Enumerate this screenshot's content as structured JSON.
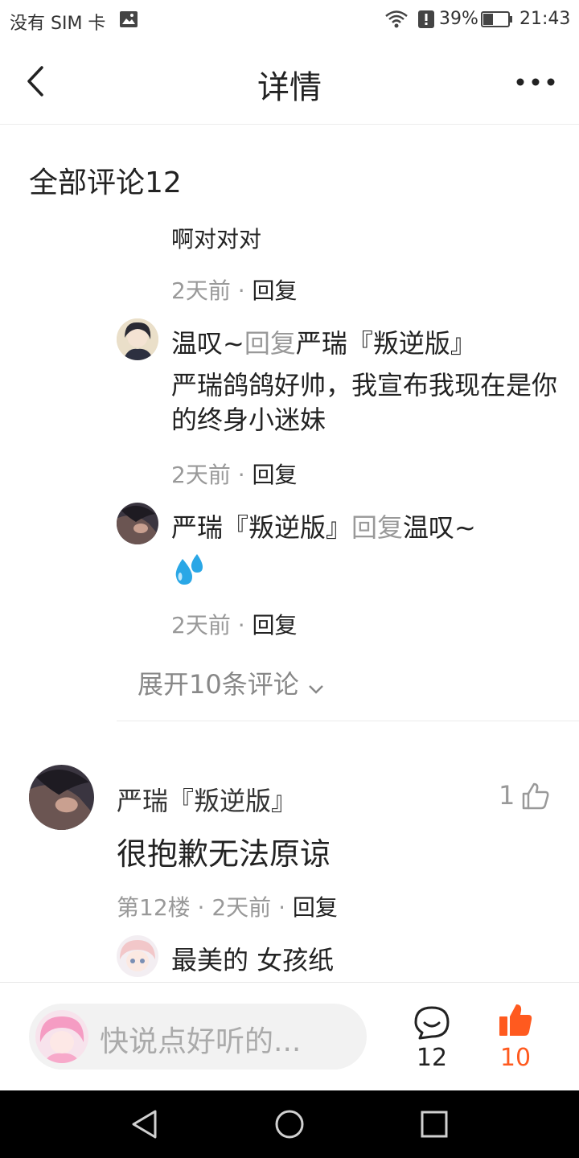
{
  "status_bar": {
    "carrier": "没有 SIM 卡",
    "battery": "39%",
    "time": "21:43",
    "battery_level": 0.39
  },
  "nav": {
    "title": "详情"
  },
  "comments_header": "全部评论12",
  "replies": [
    {
      "text": "啊对对对",
      "time": "2天前",
      "reply_label": "回复"
    },
    {
      "author": "温叹~",
      "reply_word": "回复",
      "target": "严瑞『叛逆版』",
      "text": "严瑞鸽鸽好帅，我宣布我现在是你的终身小迷妹",
      "time": "2天前",
      "reply_label": "回复"
    },
    {
      "author": "严瑞『叛逆版』",
      "reply_word": "回复",
      "target": "温叹~",
      "emoji_icon": "sweat-droplets-icon",
      "time": "2天前",
      "reply_label": "回复"
    }
  ],
  "expand_label": "展开10条评论",
  "main_comment": {
    "author": "严瑞『叛逆版』",
    "likes": "1",
    "text": "很抱歉无法原谅",
    "floor": "第12楼",
    "time": "2天前",
    "reply_label": "回复",
    "sub_reply_author": "最美的 女孩纸"
  },
  "bottom_bar": {
    "input_placeholder": "快说点好听的...",
    "comment_count": "12",
    "like_count": "10",
    "like_color": "#ff5a1f"
  },
  "separator": "·"
}
